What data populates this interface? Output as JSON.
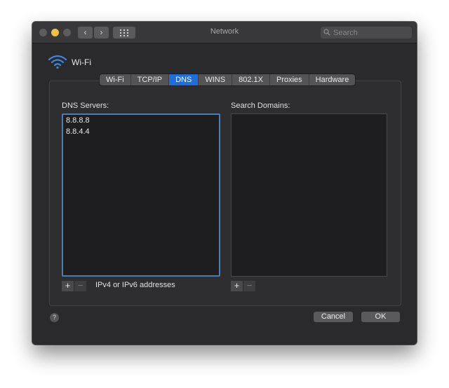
{
  "window": {
    "title": "Network",
    "search_placeholder": "Search"
  },
  "titlebar": {
    "back_glyph": "‹",
    "forward_glyph": "›"
  },
  "interface": {
    "name": "Wi-Fi",
    "icon": "wifi-icon"
  },
  "tabs": [
    {
      "label": "Wi-Fi",
      "active": false
    },
    {
      "label": "TCP/IP",
      "active": false
    },
    {
      "label": "DNS",
      "active": true
    },
    {
      "label": "WINS",
      "active": false
    },
    {
      "label": "802.1X",
      "active": false
    },
    {
      "label": "Proxies",
      "active": false
    },
    {
      "label": "Hardware",
      "active": false
    }
  ],
  "dns": {
    "label": "DNS Servers:",
    "servers": [
      "8.8.8.8",
      "8.8.4.4"
    ],
    "hint": "IPv4 or IPv6 addresses"
  },
  "search_domains": {
    "label": "Search Domains:",
    "items": []
  },
  "controls": {
    "add_glyph": "+",
    "remove_glyph": "−"
  },
  "footer": {
    "help_glyph": "?",
    "cancel_label": "Cancel",
    "ok_label": "OK"
  },
  "colors": {
    "accent": "#1f6edb",
    "traffic_minimize": "#f4c040",
    "focus_ring": "#4a7fb5"
  }
}
